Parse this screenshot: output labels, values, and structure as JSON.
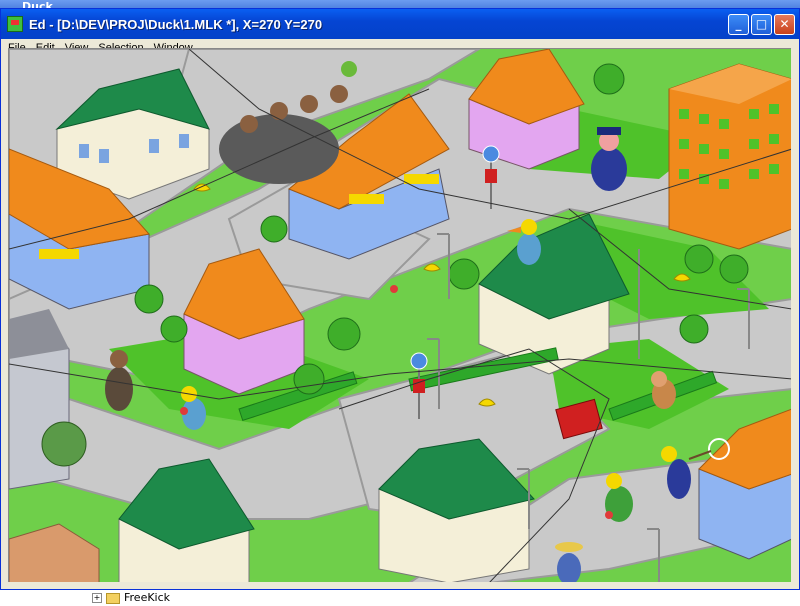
{
  "background_window": {
    "title": "Duck"
  },
  "window": {
    "title": "Ed - [D:\\DEV\\PROJ\\Duck\\1.MLK *], X=270 Y=270",
    "buttons": {
      "minimize": "_",
      "maximize": "□",
      "close": "✕"
    }
  },
  "menu": {
    "items": [
      "File",
      "Edit",
      "View",
      "Selection",
      "Window"
    ]
  },
  "tree": {
    "item_label": "FreeKick"
  },
  "colors": {
    "grass": "#6fcf4a",
    "road": "#c8c8c8",
    "roof_orange": "#f08a1c",
    "roof_green": "#1e8a4a",
    "wall_blue": "#8fb4f2",
    "wall_pink": "#e3a6f0",
    "wall_cream": "#f4efd8"
  }
}
